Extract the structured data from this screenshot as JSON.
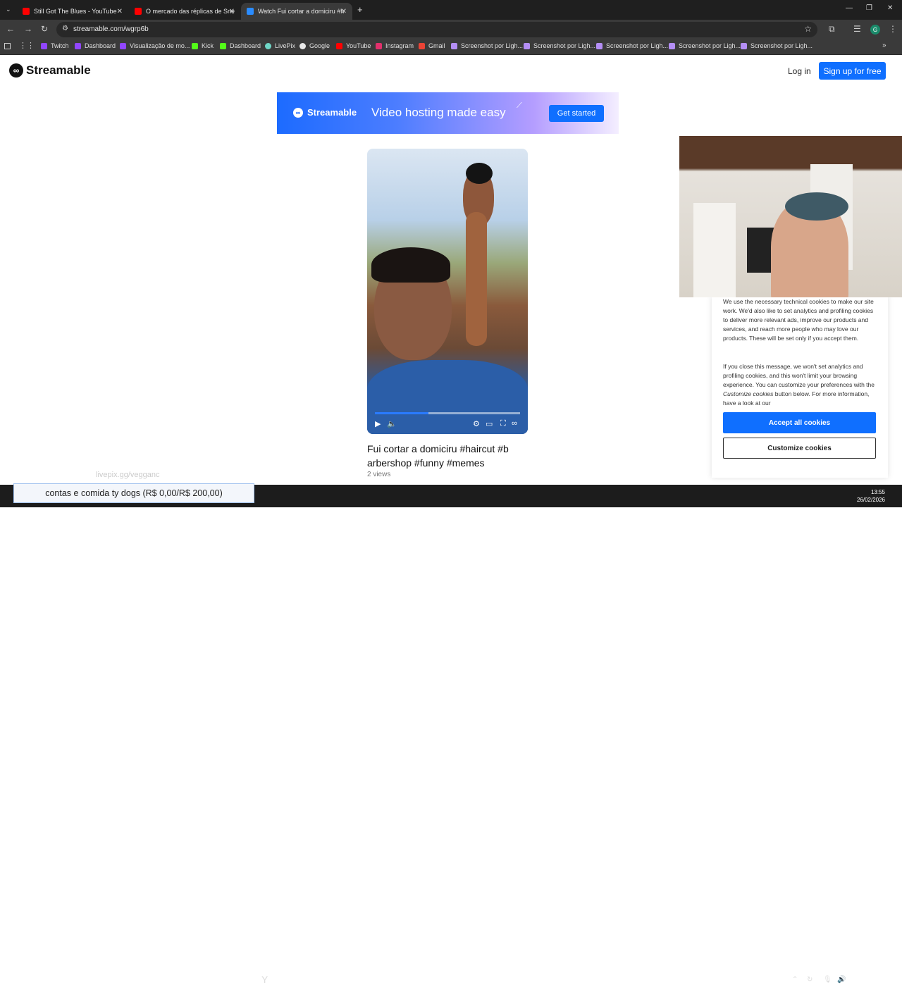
{
  "browser": {
    "tabs": [
      {
        "title": "Still Got The Blues - YouTube",
        "icon": "youtube-icon"
      },
      {
        "title": "O mercado das réplicas de Sne",
        "icon": "youtube-icon"
      },
      {
        "title": "Watch Fui cortar a domiciru #h",
        "icon": "streamable-icon"
      }
    ],
    "new_tab": "+",
    "url": "streamable.com/wgrp6b",
    "bookmarks": [
      "Twitch",
      "Dashboard",
      "Visualização de mo...",
      "Kick",
      "Dashboard",
      "LivePix",
      "Google",
      "YouTube",
      "Instagram",
      "Gmail",
      "Screenshot por Ligh...",
      "Screenshot por Ligh...",
      "Screenshot por Ligh...",
      "Screenshot por Ligh...",
      "Screenshot por Ligh..."
    ],
    "profile_initial": "G"
  },
  "header": {
    "logo_text": "Streamable",
    "login": "Log in",
    "signup": "Sign up for free"
  },
  "banner": {
    "brand": "Streamable",
    "tagline": "Video hosting made easy",
    "cta": "Get started"
  },
  "video": {
    "progress_fraction": 0.37,
    "title": "Fui cortar a domiciru #haircut #b arbershop #funny #memes",
    "views": "2 views"
  },
  "cookie": {
    "text1": "We use the necessary technical cookies to make our site work. We'd also like to set analytics and profiling cookies to deliver more relevant ads, improve our products and services, and reach more people who may love our products. These will be set only if you accept them.",
    "text2_a": "If you close this message, we won't set analytics and profiling cookies, and this won't limit your browsing experience. You can customize your preferences with the",
    "text2_em": "Customize cookies",
    "text2_b": "button below. For more information, have a look at our",
    "accept": "Accept all cookies",
    "customize": "Customize cookies"
  },
  "overlay": {
    "watermark": "livepix.gg/vegganc",
    "donation_bar": "contas e comida ty dogs (R$ 0,00/R$ 200,00)"
  },
  "taskbar": {
    "time": "13:55",
    "date": "26/02/2026"
  }
}
